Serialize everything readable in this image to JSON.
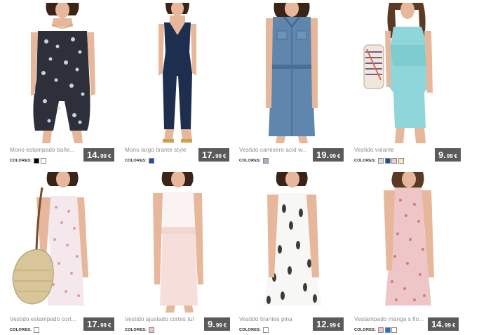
{
  "colors_label": "COLORES:",
  "products": [
    {
      "name": "Mono estampado bañe...",
      "price_whole": "14.",
      "price_cents": "99",
      "currency": "€",
      "swatches": [
        "#000000",
        "#ffffff"
      ]
    },
    {
      "name": "Mono largo tirante style",
      "price_whole": "17.",
      "price_cents": "99",
      "currency": "€",
      "swatches": [
        "#1f4f9a"
      ]
    },
    {
      "name": "Vestido camisero acid w...",
      "price_whole": "19.",
      "price_cents": "99",
      "currency": "€",
      "swatches": [
        "#9fb0cf"
      ]
    },
    {
      "name": "Vestido volante",
      "price_whole": "9.",
      "price_cents": "99",
      "currency": "€",
      "swatches": [
        "#cfe6d8",
        "#1f4f9a",
        "#f3c6d4",
        "#f5f0a8"
      ]
    },
    {
      "name": "Vestido estampado cort...",
      "price_whole": "17.",
      "price_cents": "99",
      "currency": "€",
      "swatches": [
        "#ffffff"
      ]
    },
    {
      "name": "Vestido ajustado cortes tul",
      "price_whole": "9.",
      "price_cents": "99",
      "currency": "€",
      "swatches": [
        "#f2c4cf"
      ]
    },
    {
      "name": "Vestido tirantes pina",
      "price_whole": "12.",
      "price_cents": "99",
      "currency": "€",
      "swatches": [
        "#ffffff"
      ]
    },
    {
      "name": "Vestampado manga s flo...",
      "price_whole": "14.",
      "price_cents": "99",
      "currency": "€",
      "swatches": [
        "#f2c4cf",
        "#1f6fd0",
        "#ffffff"
      ]
    }
  ]
}
